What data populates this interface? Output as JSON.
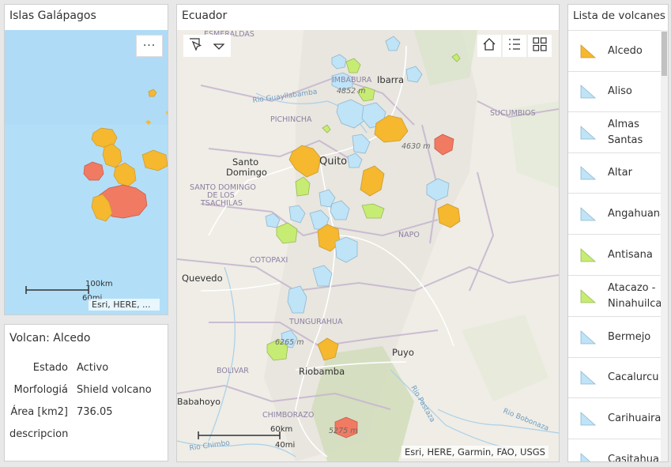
{
  "galapagos": {
    "title": "Islas Galápagos",
    "menu_label": "···",
    "scale_km": "100km",
    "scale_mi": "60mi",
    "attribution": "Esri, HERE, ..."
  },
  "info": {
    "title": "Volcan: Alcedo",
    "rows": [
      {
        "label": "Estado",
        "value": "Activo"
      },
      {
        "label": "Morfologiá",
        "value": "Shield volcano"
      },
      {
        "label": "Área [km2]",
        "value": "736.05"
      },
      {
        "label": "descripcion",
        "value": ""
      }
    ]
  },
  "ecuador": {
    "title": "Ecuador",
    "scale_km": "60km",
    "scale_mi": "40mi",
    "attribution": "Esri, HERE, Garmin, FAO, USGS",
    "places": {
      "ibarra": "Ibarra",
      "quito": "Quito",
      "santo_domingo_1": "Santo",
      "santo_domingo_2": "Domingo",
      "quevedo": "Quevedo",
      "riobamba": "Riobamba",
      "babahoyo": "Babahoyo",
      "puyo": "Puyo",
      "esmeraldas_top": "ESMERALDAS",
      "imbabura": "IMBABURA",
      "pichincha": "PICHINCHA",
      "sucumbios": "SUCUMBIOS",
      "napo": "NAPO",
      "cotopaxi": "COTOPAXI",
      "tsachilas_1": "SANTO DOMINGO",
      "tsachilas_2": "DE LOS",
      "tsachilas_3": "TSACHILAS",
      "tungurahua": "TUNGURAHUA",
      "bolivar": "BOLIVAR",
      "chimborazo": "CHIMBORAZO",
      "rio_guayllabamba": "Rio Guayllabamba",
      "rio_pastaza": "Rio Pastaza",
      "rio_bobonaza": "Rio Bobonaza",
      "rio_chimbo": "Rio Chimbo",
      "elev_4852": "4852 m",
      "elev_4630": "4630 m",
      "elev_6265": "6265 m",
      "elev_5275": "5275 m"
    }
  },
  "volcano_list": {
    "title": "Lista de volcanes",
    "items": [
      {
        "name": "Alcedo",
        "color": "#f5b82e"
      },
      {
        "name": "Aliso",
        "color": "#bfe3f7"
      },
      {
        "name": "Almas Santas",
        "color": "#bfe3f7"
      },
      {
        "name": "Altar",
        "color": "#bfe3f7"
      },
      {
        "name": "Angahuana",
        "color": "#bfe3f7"
      },
      {
        "name": "Antisana",
        "color": "#c6ec73"
      },
      {
        "name": "Atacazo - Ninahuilca",
        "color": "#c6ec73"
      },
      {
        "name": "Bermejo",
        "color": "#bfe3f7"
      },
      {
        "name": "Cacalurcu",
        "color": "#bfe3f7"
      },
      {
        "name": "Carihuairazo",
        "color": "#bfe3f7"
      },
      {
        "name": "Casitahua",
        "color": "#bfe3f7"
      }
    ]
  },
  "colors": {
    "ocean": "#b2dff7",
    "land": "#f2efe6",
    "orange": "#f5b82e",
    "red": "#f07a62",
    "blue": "#bfe3f7",
    "green": "#c6ec73"
  }
}
